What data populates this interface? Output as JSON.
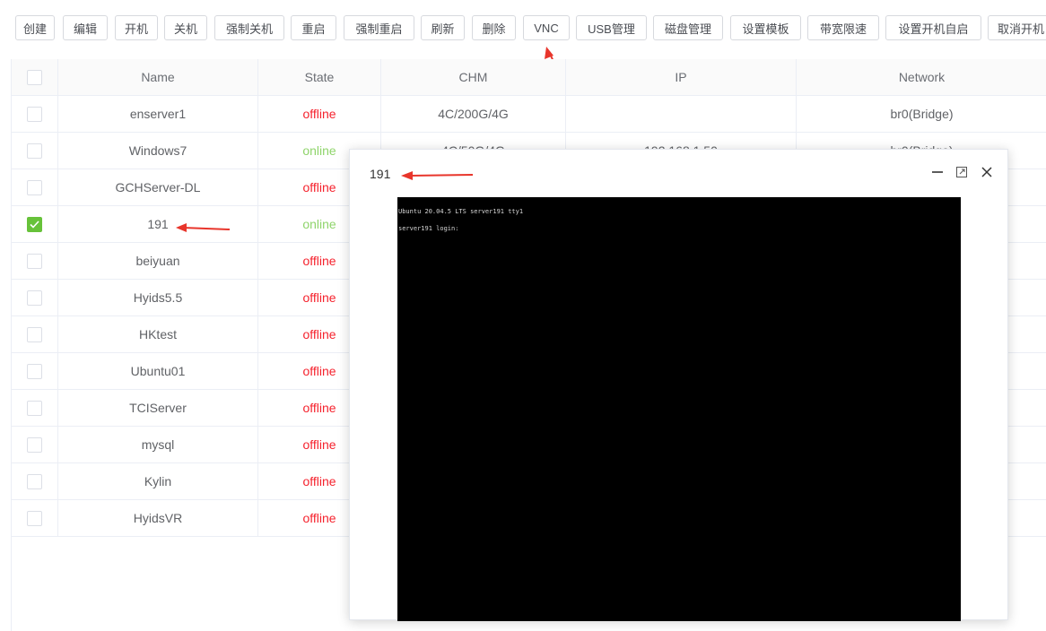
{
  "toolbar": {
    "buttons": [
      "创建",
      "编辑",
      "开机",
      "关机",
      "强制关机",
      "重启",
      "强制重启",
      "刷新",
      "删除",
      "VNC",
      "USB管理",
      "磁盘管理",
      "设置模板",
      "带宽限速",
      "设置开机自启",
      "取消开机"
    ]
  },
  "table": {
    "columns": {
      "name": "Name",
      "state": "State",
      "chm": "CHM",
      "ip": "IP",
      "network": "Network"
    },
    "rows": [
      {
        "name": "enserver1",
        "state": "offline",
        "chm": "4C/200G/4G",
        "ip": "",
        "network": "br0(Bridge)",
        "checked": false
      },
      {
        "name": "Windows7",
        "state": "online",
        "chm": "4C/50G/4G",
        "ip": "192.168.1.50",
        "network": "br0(Bridge)",
        "checked": false
      },
      {
        "name": "GCHServer-DL",
        "state": "offline",
        "chm": "",
        "ip": "",
        "network": "",
        "checked": false
      },
      {
        "name": "191",
        "state": "online",
        "chm": "",
        "ip": "",
        "network": "",
        "checked": true
      },
      {
        "name": "beiyuan",
        "state": "offline",
        "chm": "",
        "ip": "",
        "network": "",
        "checked": false
      },
      {
        "name": "Hyids5.5",
        "state": "offline",
        "chm": "",
        "ip": "",
        "network": "",
        "checked": false
      },
      {
        "name": "HKtest",
        "state": "offline",
        "chm": "",
        "ip": "",
        "network": "",
        "checked": false
      },
      {
        "name": "Ubuntu01",
        "state": "offline",
        "chm": "",
        "ip": "",
        "network": "",
        "checked": false
      },
      {
        "name": "TCIServer",
        "state": "offline",
        "chm": "",
        "ip": "",
        "network": "",
        "checked": false
      },
      {
        "name": "mysql",
        "state": "offline",
        "chm": "",
        "ip": "",
        "network": "",
        "checked": false
      },
      {
        "name": "Kylin",
        "state": "offline",
        "chm": "",
        "ip": "",
        "network": "",
        "checked": false
      },
      {
        "name": "HyidsVR",
        "state": "offline",
        "chm": "",
        "ip": "",
        "network": "",
        "checked": false
      }
    ]
  },
  "dialog": {
    "title": "191",
    "console_lines": [
      "Ubuntu 20.04.5 LTS server191 tty1",
      "server191 login:"
    ]
  },
  "colors": {
    "offline": "#f5222d",
    "online": "#8fd46b",
    "arrow": "#e8352b",
    "checked": "#67c23a"
  },
  "icons": [
    "minimize-icon",
    "maximize-icon",
    "close-icon",
    "check-icon",
    "expand-arrow-icon"
  ]
}
